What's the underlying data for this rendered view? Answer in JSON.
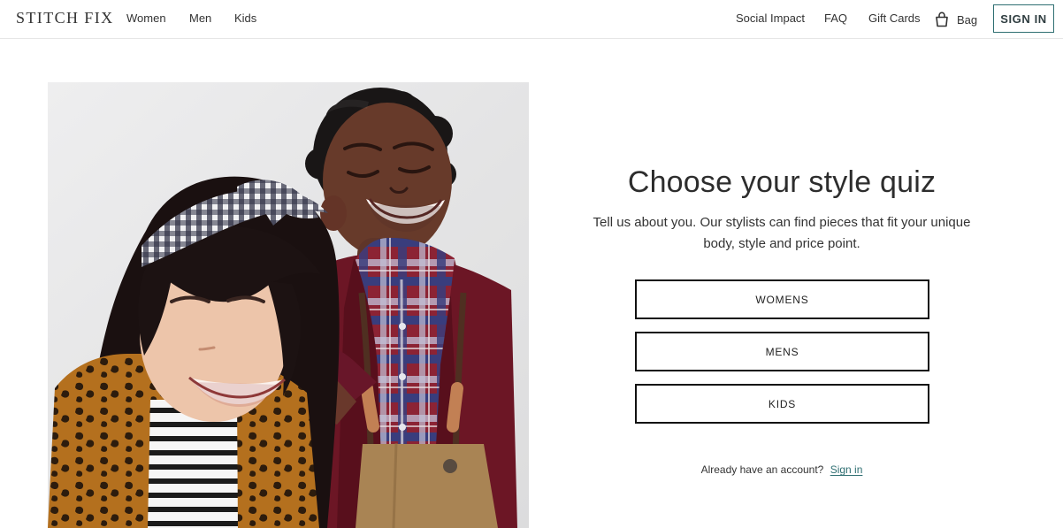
{
  "header": {
    "logo": "STITCH FIX",
    "nav_left": [
      {
        "label": "Women"
      },
      {
        "label": "Men"
      },
      {
        "label": "Kids"
      }
    ],
    "nav_right": [
      {
        "label": "Social Impact"
      },
      {
        "label": "FAQ"
      },
      {
        "label": "Gift Cards"
      }
    ],
    "bag_label": "Bag",
    "signin_label": "SIGN IN",
    "bag_icon": "shopping-bag-icon"
  },
  "main": {
    "headline": "Choose your style quiz",
    "subtitle": "Tell us about you. Our stylists can find pieces that fit your unique body, style and price point.",
    "quiz_buttons": [
      {
        "label": "WOMENS"
      },
      {
        "label": "MENS"
      },
      {
        "label": "KIDS"
      }
    ],
    "account_prompt": "Already have an account?",
    "account_link": "Sign in"
  },
  "colors": {
    "accent": "#2f6f72",
    "text": "#333333",
    "border": "#111111"
  }
}
